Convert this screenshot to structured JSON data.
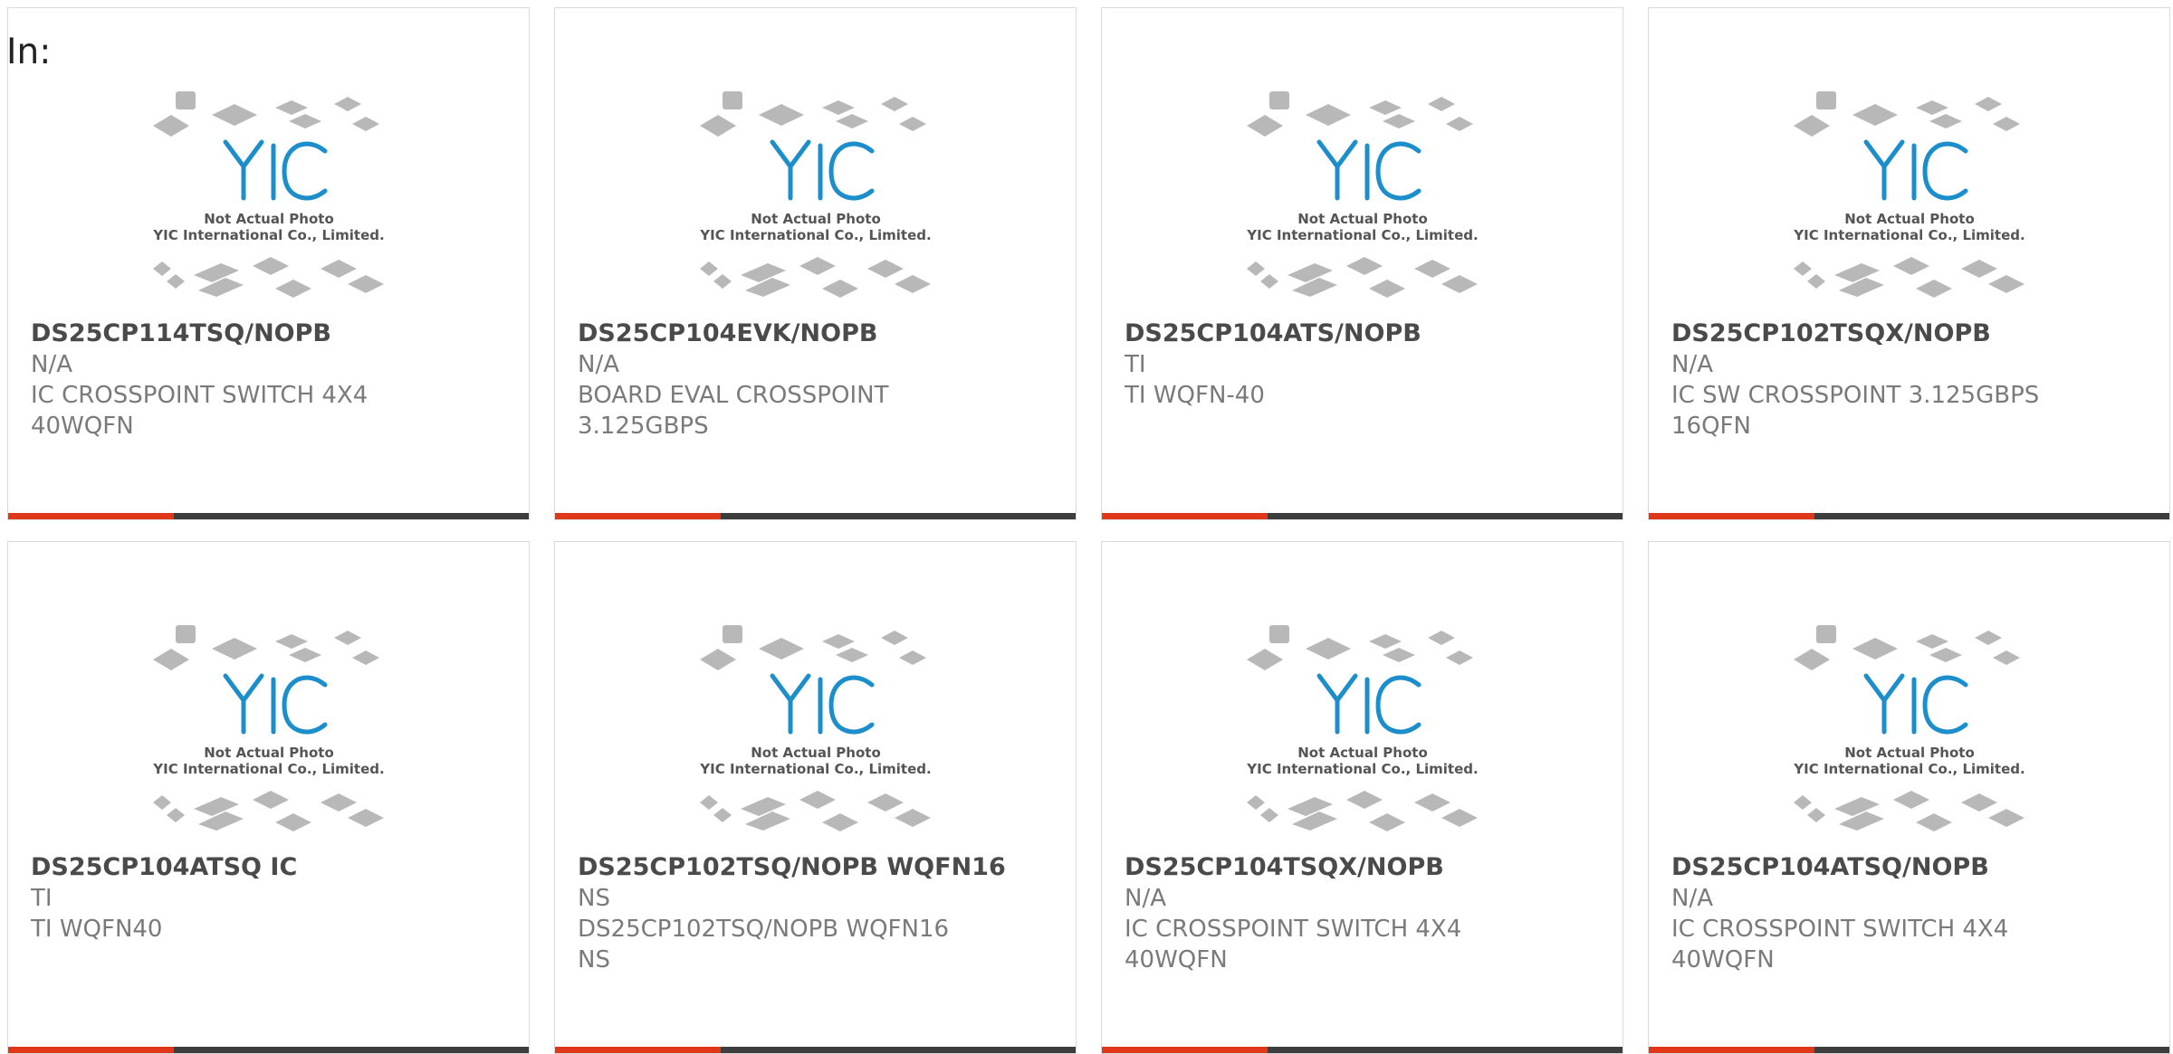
{
  "heading": "In:",
  "photo": {
    "brand": "YIC",
    "caption_line1": "Not Actual Photo",
    "caption_line2": "YIC International Co., Limited.",
    "accent_color": "#e0361a",
    "bar_color": "#3d3d3d",
    "logo_color": "#1c8ecb"
  },
  "products": [
    {
      "part_number": "DS25CP114TSQ/NOPB",
      "manufacturer": "N/A",
      "description_lines": [
        "IC CROSSPOINT SWITCH 4X4",
        "40WQFN"
      ]
    },
    {
      "part_number": "DS25CP104EVK/NOPB",
      "manufacturer": "N/A",
      "description_lines": [
        "BOARD EVAL CROSSPOINT",
        "3.125GBPS"
      ]
    },
    {
      "part_number": "DS25CP104ATS/NOPB",
      "manufacturer": "TI",
      "description_lines": [
        "TI WQFN-40",
        ""
      ]
    },
    {
      "part_number": "DS25CP102TSQX/NOPB",
      "manufacturer": "N/A",
      "description_lines": [
        "IC SW CROSSPOINT 3.125GBPS",
        "16QFN"
      ]
    },
    {
      "part_number": "DS25CP104ATSQ IC",
      "manufacturer": "TI",
      "description_lines": [
        "TI WQFN40",
        ""
      ]
    },
    {
      "part_number": "DS25CP102TSQ/NOPB WQFN16",
      "manufacturer": "NS",
      "description_lines": [
        "DS25CP102TSQ/NOPB WQFN16",
        "NS"
      ]
    },
    {
      "part_number": "DS25CP104TSQX/NOPB",
      "manufacturer": "N/A",
      "description_lines": [
        "IC CROSSPOINT SWITCH 4X4",
        "40WQFN"
      ]
    },
    {
      "part_number": "DS25CP104ATSQ/NOPB",
      "manufacturer": "N/A",
      "description_lines": [
        "IC CROSSPOINT SWITCH 4X4",
        "40WQFN"
      ]
    }
  ]
}
